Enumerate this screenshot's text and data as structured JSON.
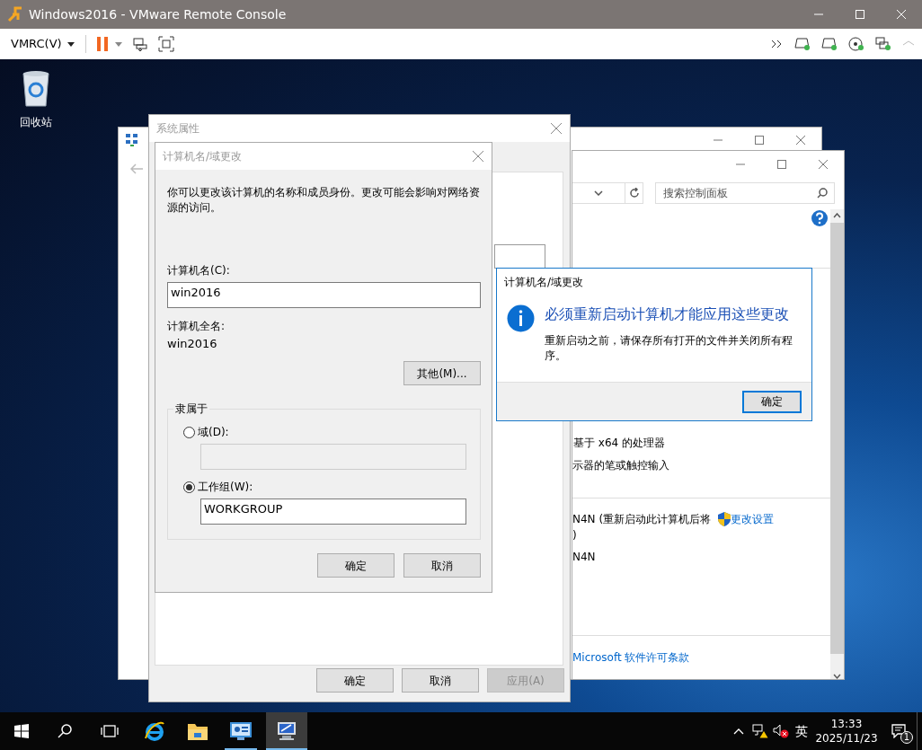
{
  "app_window": {
    "title": "Windows2016 - VMware Remote Console"
  },
  "toolbar": {
    "menu_label": "VMRC(V)"
  },
  "desktop_icons": [
    {
      "label": "回收站"
    }
  ],
  "network_window": {
    "kind": "window"
  },
  "control_panel": {
    "search": {
      "placeholder": "搜索控制面板"
    },
    "processor": "基于 x64 的处理器",
    "pen": "示器的笔或触控输入",
    "pending_name": "N4N (重新启动此计算机后将",
    "pending_name_end": ")",
    "change_link": "更改设置",
    "name": "N4N",
    "license_link": "Microsoft 软件许可条款"
  },
  "system_properties": {
    "title": "系统属性",
    "buttons": [
      {
        "label": "确定",
        "disabled": false
      },
      {
        "label": "取消",
        "disabled": false
      },
      {
        "label": "应用(A)",
        "disabled": true
      }
    ]
  },
  "name_dialog": {
    "title": "计算机名/域更改",
    "description": "你可以更改该计算机的名称和成员身份。更改可能会影响对网络资源的访问。",
    "computer_name_label": "计算机名(C):",
    "computer_name": "win2016",
    "full_name_label": "计算机全名:",
    "full_name": "win2016",
    "more_button": "其他(M)...",
    "member_of": {
      "legend": "隶属于",
      "options": [
        {
          "label": "域(D):",
          "selected": false
        },
        {
          "label": "工作组(W):",
          "selected": true,
          "value": "WORKGROUP"
        }
      ]
    },
    "buttons": [
      "确定",
      "取消"
    ]
  },
  "message_box": {
    "title": "计算机名/域更改",
    "heading": "必须重新启动计算机才能应用这些更改",
    "body": "重新启动之前，请保存所有打开的文件并关闭所有程序。",
    "button": "确定"
  },
  "taskbar": {
    "apps": [
      {
        "kind": "browser",
        "selected": false,
        "running": false
      },
      {
        "kind": "folder",
        "selected": false,
        "running": false
      },
      {
        "kind": "control-panel",
        "selected": false,
        "running": true
      },
      {
        "kind": "system",
        "selected": true,
        "running": true
      }
    ],
    "tray": {
      "language": "英",
      "time": "13:33",
      "date": "2025/11/23",
      "notifications": "1"
    }
  }
}
